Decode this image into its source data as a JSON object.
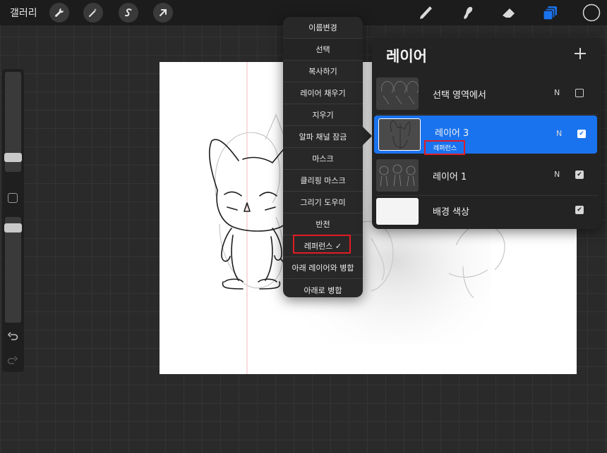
{
  "topbar": {
    "gallery_label": "갤러리",
    "left_tools": [
      "wrench-icon",
      "magic-wand-icon",
      "selection-s-icon",
      "arrow-transform-icon"
    ],
    "right_tools": [
      "brush-icon",
      "smudge-icon",
      "eraser-icon",
      "layers-icon",
      "color-circle-icon"
    ]
  },
  "layer_menu": {
    "items": [
      "이름변경",
      "선택",
      "복사하기",
      "레이어 채우기",
      "지우기",
      "알파 채널 잠금",
      "마스크",
      "클리핑 마스크",
      "그리기 도우미",
      "반전",
      "레퍼런스 ✓",
      "아래 레이어와 병합",
      "아래로 병합"
    ]
  },
  "layers_panel": {
    "title": "레이어",
    "layers": [
      {
        "name": "선택 영역에서",
        "mode": "N",
        "visible": false
      },
      {
        "name": "레이어 3",
        "mode": "N",
        "visible": true,
        "sublabel": "레퍼런스"
      },
      {
        "name": "레이어 1",
        "mode": "N",
        "visible": true
      },
      {
        "name": "배경 색상",
        "mode": "",
        "visible": true
      }
    ]
  },
  "colors": {
    "accent": "#1a73ee",
    "highlight": "#e01c24"
  }
}
